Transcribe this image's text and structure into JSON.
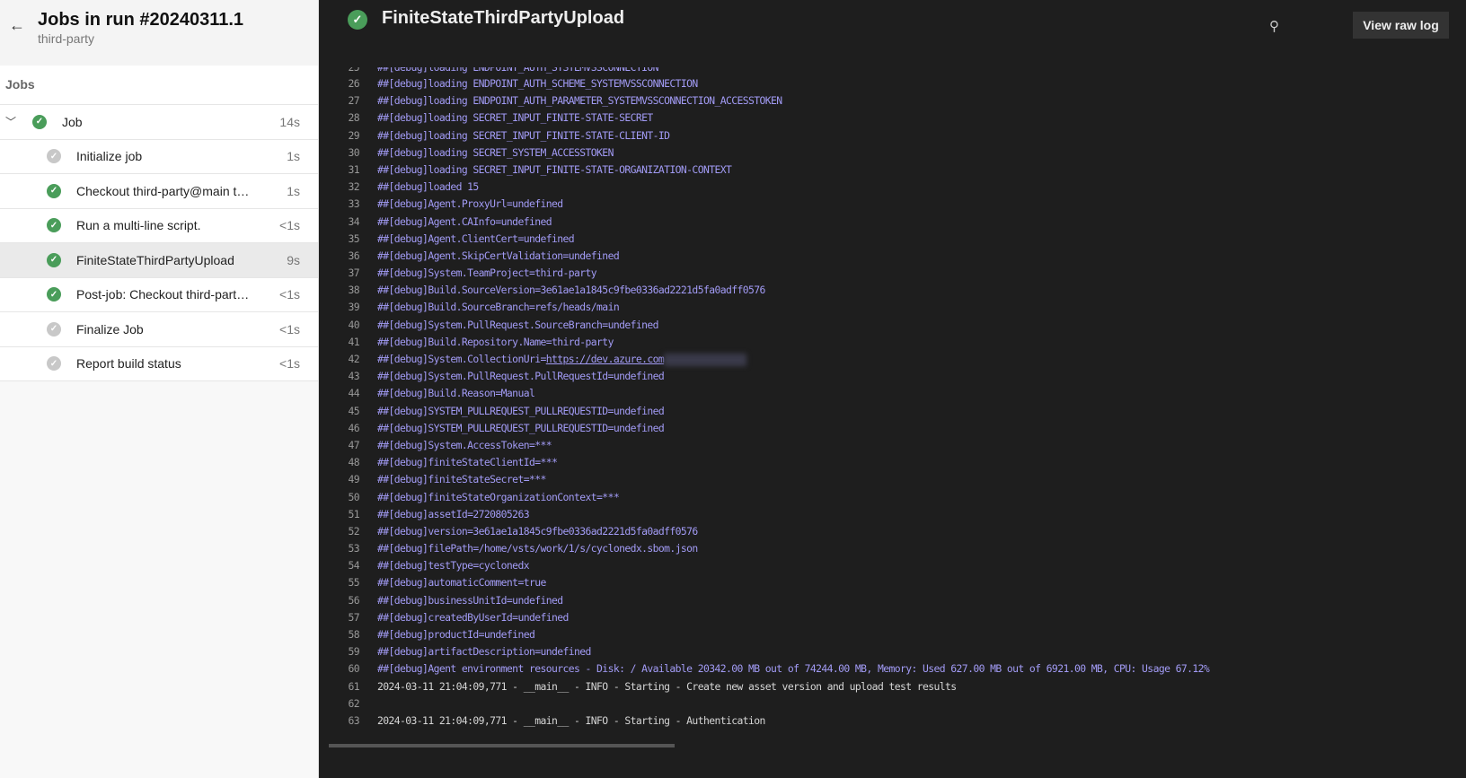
{
  "sidebar": {
    "title": "Jobs in run #20240311.1",
    "subtitle": "third-party",
    "section": "Jobs",
    "job": {
      "label": "Job",
      "duration": "14s",
      "status": "success"
    },
    "steps": [
      {
        "label": "Initialize job",
        "duration": "1s",
        "status": "skipped"
      },
      {
        "label": "Checkout third-party@main to s",
        "duration": "1s",
        "status": "success"
      },
      {
        "label": "Run a multi-line script.",
        "duration": "<1s",
        "status": "success"
      },
      {
        "label": "FiniteStateThirdPartyUpload",
        "duration": "9s",
        "status": "success",
        "selected": true
      },
      {
        "label": "Post-job: Checkout third-party…",
        "duration": "<1s",
        "status": "success"
      },
      {
        "label": "Finalize Job",
        "duration": "<1s",
        "status": "skipped"
      },
      {
        "label": "Report build status",
        "duration": "<1s",
        "status": "skipped"
      }
    ]
  },
  "header": {
    "title": "FiniteStateThirdPartyUpload",
    "view_raw": "View raw log"
  },
  "colors": {
    "success": "#4a9d5a",
    "debug": "#a29bf5"
  },
  "log": [
    {
      "n": "26",
      "t": "##[debug]loading ENDPOINT_AUTH_SCHEME_SYSTEMVSSCONNECTION",
      "k": "dbg"
    },
    {
      "n": "27",
      "t": "##[debug]loading ENDPOINT_AUTH_PARAMETER_SYSTEMVSSCONNECTION_ACCESSTOKEN",
      "k": "dbg"
    },
    {
      "n": "28",
      "t": "##[debug]loading SECRET_INPUT_FINITE-STATE-SECRET",
      "k": "dbg"
    },
    {
      "n": "29",
      "t": "##[debug]loading SECRET_INPUT_FINITE-STATE-CLIENT-ID",
      "k": "dbg"
    },
    {
      "n": "30",
      "t": "##[debug]loading SECRET_SYSTEM_ACCESSTOKEN",
      "k": "dbg"
    },
    {
      "n": "31",
      "t": "##[debug]loading SECRET_INPUT_FINITE-STATE-ORGANIZATION-CONTEXT",
      "k": "dbg"
    },
    {
      "n": "32",
      "t": "##[debug]loaded 15",
      "k": "dbg"
    },
    {
      "n": "33",
      "t": "##[debug]Agent.ProxyUrl=undefined",
      "k": "dbg"
    },
    {
      "n": "34",
      "t": "##[debug]Agent.CAInfo=undefined",
      "k": "dbg"
    },
    {
      "n": "35",
      "t": "##[debug]Agent.ClientCert=undefined",
      "k": "dbg"
    },
    {
      "n": "36",
      "t": "##[debug]Agent.SkipCertValidation=undefined",
      "k": "dbg"
    },
    {
      "n": "37",
      "t": "##[debug]System.TeamProject=third-party",
      "k": "dbg"
    },
    {
      "n": "38",
      "t": "##[debug]Build.SourceVersion=3e61ae1a1845c9fbe0336ad2221d5fa0adff0576",
      "k": "dbg"
    },
    {
      "n": "39",
      "t": "##[debug]Build.SourceBranch=refs/heads/main",
      "k": "dbg"
    },
    {
      "n": "40",
      "t": "##[debug]System.PullRequest.SourceBranch=undefined",
      "k": "dbg"
    },
    {
      "n": "41",
      "t": "##[debug]Build.Repository.Name=third-party",
      "k": "dbg"
    },
    {
      "n": "42",
      "t": "##[debug]System.CollectionUri=",
      "k": "dbg",
      "link": "https://dev.azure.com"
    },
    {
      "n": "43",
      "t": "##[debug]System.PullRequest.PullRequestId=undefined",
      "k": "dbg"
    },
    {
      "n": "44",
      "t": "##[debug]Build.Reason=Manual",
      "k": "dbg"
    },
    {
      "n": "45",
      "t": "##[debug]SYSTEM_PULLREQUEST_PULLREQUESTID=undefined",
      "k": "dbg"
    },
    {
      "n": "46",
      "t": "##[debug]SYSTEM_PULLREQUEST_PULLREQUESTID=undefined",
      "k": "dbg"
    },
    {
      "n": "47",
      "t": "##[debug]System.AccessToken=***",
      "k": "dbg"
    },
    {
      "n": "48",
      "t": "##[debug]finiteStateClientId=***",
      "k": "dbg"
    },
    {
      "n": "49",
      "t": "##[debug]finiteStateSecret=***",
      "k": "dbg"
    },
    {
      "n": "50",
      "t": "##[debug]finiteStateOrganizationContext=***",
      "k": "dbg"
    },
    {
      "n": "51",
      "t": "##[debug]assetId=2720805263",
      "k": "dbg"
    },
    {
      "n": "52",
      "t": "##[debug]version=3e61ae1a1845c9fbe0336ad2221d5fa0adff0576",
      "k": "dbg"
    },
    {
      "n": "53",
      "t": "##[debug]filePath=/home/vsts/work/1/s/cyclonedx.sbom.json",
      "k": "dbg"
    },
    {
      "n": "54",
      "t": "##[debug]testType=cyclonedx",
      "k": "dbg"
    },
    {
      "n": "55",
      "t": "##[debug]automaticComment=true",
      "k": "dbg"
    },
    {
      "n": "56",
      "t": "##[debug]businessUnitId=undefined",
      "k": "dbg"
    },
    {
      "n": "57",
      "t": "##[debug]createdByUserId=undefined",
      "k": "dbg"
    },
    {
      "n": "58",
      "t": "##[debug]productId=undefined",
      "k": "dbg"
    },
    {
      "n": "59",
      "t": "##[debug]artifactDescription=undefined",
      "k": "dbg"
    },
    {
      "n": "60",
      "t": "##[debug]Agent environment resources - Disk: / Available 20342.00 MB out of 74244.00 MB, Memory: Used 627.00 MB out of 6921.00 MB, CPU: Usage 67.12%",
      "k": "dbg"
    },
    {
      "n": "61",
      "t": "2024-03-11 21:04:09,771 - __main__ - INFO - Starting - Create new asset version and upload test results",
      "k": "info"
    },
    {
      "n": "62",
      "t": "",
      "k": "info"
    },
    {
      "n": "63",
      "t": "2024-03-11 21:04:09,771 - __main__ - INFO - Starting - Authentication",
      "k": "info"
    }
  ]
}
